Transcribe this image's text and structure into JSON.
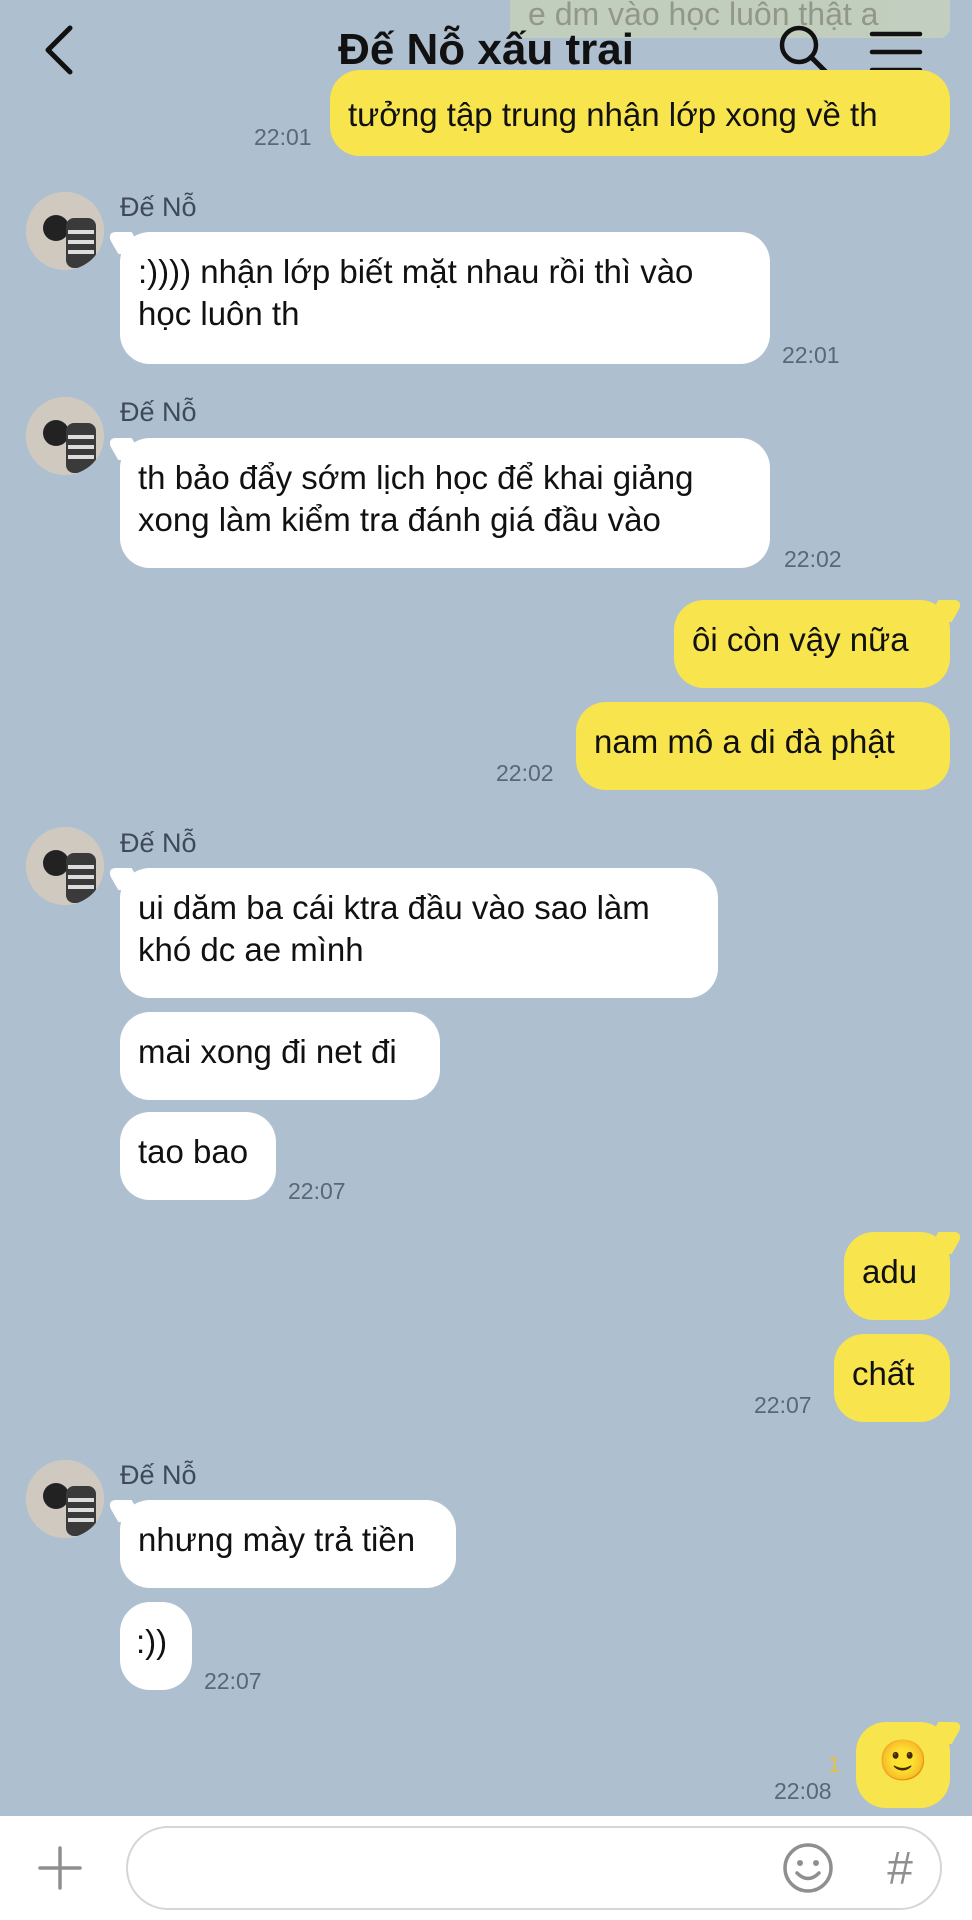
{
  "header": {
    "title": "Đế Nỗ xấu trai",
    "peek_text": "e dm vào học luôn thật a"
  },
  "messages": {
    "m0": {
      "text": "tưởng tập trung nhận lớp xong về th",
      "time": "22:01"
    },
    "m1": {
      "sender": "Đế Nỗ",
      "lines": [
        ":)))) nhận lớp biết mặt nhau rồi thì vào",
        "học luôn th"
      ],
      "time": "22:01"
    },
    "m2": {
      "sender": "Đế Nỗ",
      "lines": [
        "th bảo đẩy sớm lịch học để khai giảng",
        "xong làm kiểm tra đánh giá đầu vào"
      ],
      "time": "22:02"
    },
    "m3": {
      "text": "ôi còn vậy nữa"
    },
    "m4": {
      "text": "nam mô a di đà phật",
      "time": "22:02"
    },
    "m5": {
      "sender": "Đế Nỗ",
      "lines": [
        "ui dăm ba cái ktra đầu vào sao làm",
        "khó dc ae mình"
      ]
    },
    "m6": {
      "text": "mai xong đi net đi"
    },
    "m7": {
      "text": "tao bao",
      "time": "22:07"
    },
    "m8": {
      "text": "adu"
    },
    "m9": {
      "text": "chất",
      "time": "22:07"
    },
    "m10": {
      "sender": "Đế Nỗ",
      "text": "nhưng mày trả tiền"
    },
    "m11": {
      "text": ":))",
      "time": "22:07"
    },
    "m12": {
      "unread": "1",
      "time": "22:08",
      "emoji": "🙂"
    }
  },
  "input": {
    "placeholder": ""
  },
  "icons": {
    "back": "chevron-left-icon",
    "search": "search-icon",
    "menu": "hamburger-menu-icon",
    "plus": "plus-icon",
    "emoji": "smiley-icon",
    "hash": "hash-icon"
  },
  "colors": {
    "background": "#aebfd0",
    "outgoing_bubble": "#f8e54e",
    "incoming_bubble": "#ffffff",
    "unread": "#e8c23a"
  }
}
